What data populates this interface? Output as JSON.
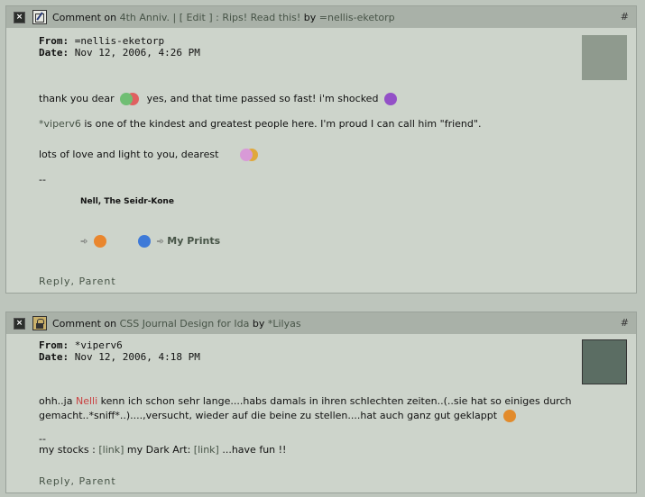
{
  "comments": [
    {
      "header": {
        "prefix": "Comment on",
        "title": "4th Anniv. | [ Edit ] : Rips! Read this!",
        "by_label": "by",
        "author": "=nellis-eketorp",
        "hash": "#"
      },
      "from_label": "From:",
      "from_value": "=nellis-eketorp",
      "date_label": "Date:",
      "date_value": "Nov 12, 2006, 4:26 PM",
      "line1_a": "thank you dear",
      "line1_b": "yes, and that time passed so fast! i'm shocked",
      "line2_link": "*viperv6",
      "line2_rest": " is one of the kindest and greatest people here. I'm proud I can call him \"friend\".",
      "line3": "lots of love and light to you, dearest",
      "sep": "--",
      "signature": "Nell, The Seidr-Kone",
      "prints_label": "My Prints",
      "reply_label": "Reply",
      "parent_label": "Parent"
    },
    {
      "header": {
        "prefix": "Comment on",
        "title": "CSS Journal Design for Ida",
        "by_label": "by",
        "author": "*Lilyas",
        "hash": "#"
      },
      "from_label": "From:",
      "from_value": "*viperv6",
      "date_label": "Date:",
      "date_value": "Nov 12, 2006, 4:18 PM",
      "line1_a": "ohh..ja",
      "line1_name": "Nelli",
      "line1_b": "kenn ich schon sehr lange....habs damals in ihren schlechten zeiten..(..sie hat so einiges durch",
      "line2": "gemacht..*sniff*..)....,versucht, wieder auf die beine zu stellen....hat auch ganz gut geklappt",
      "sep": "--",
      "stocks_a": "my stocks :",
      "stocks_link1": "[link]",
      "stocks_b": "my Dark Art:",
      "stocks_link2": "[link]",
      "stocks_c": "...have fun !!",
      "reply_label": "Reply",
      "parent_label": "Parent"
    }
  ]
}
